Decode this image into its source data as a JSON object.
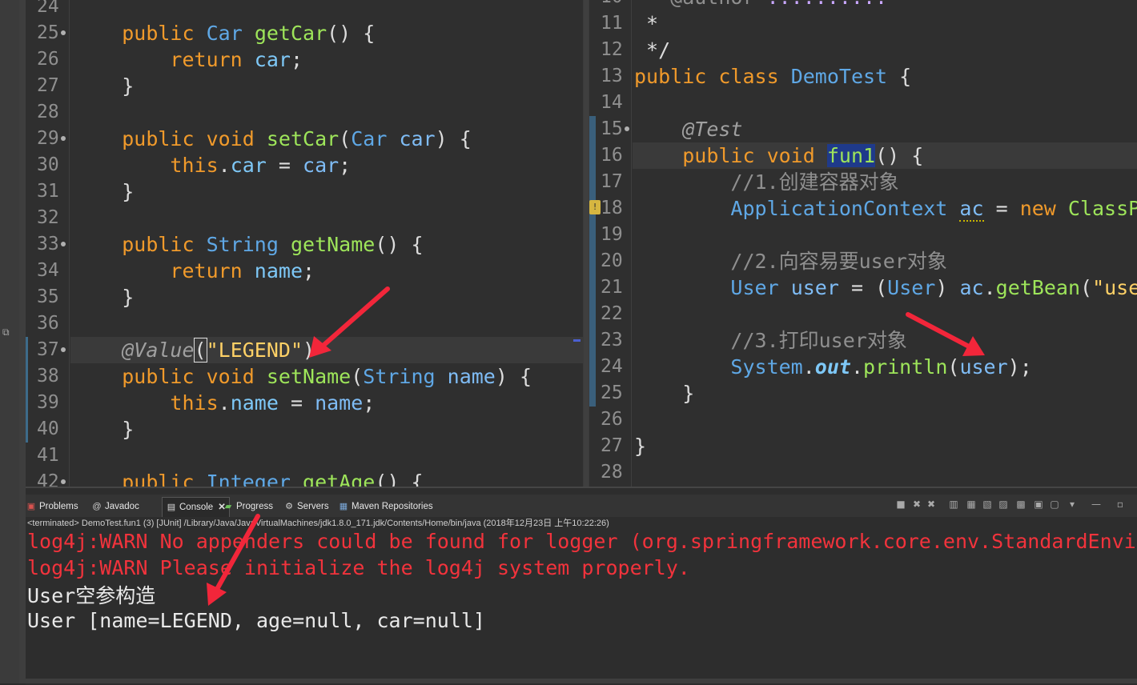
{
  "left_editor": {
    "lines": [
      {
        "num": "24",
        "fold": false,
        "html": ""
      },
      {
        "num": "25",
        "fold": true,
        "html": "    <span class=\"kw\">public</span> <span class=\"ty\">Car</span> <span class=\"fn\">getCar</span>() {"
      },
      {
        "num": "26",
        "fold": false,
        "html": "        <span class=\"kw\">return</span> <span class=\"fld\">car</span>;"
      },
      {
        "num": "27",
        "fold": false,
        "html": "    }"
      },
      {
        "num": "28",
        "fold": false,
        "html": ""
      },
      {
        "num": "29",
        "fold": true,
        "html": "    <span class=\"kw\">public void</span> <span class=\"fn\">setCar</span>(<span class=\"ty\">Car</span> <span class=\"vr\">car</span>) {"
      },
      {
        "num": "30",
        "fold": false,
        "html": "        <span class=\"kw\">this</span>.<span class=\"fld\">car</span> = <span class=\"vr\">car</span>;"
      },
      {
        "num": "31",
        "fold": false,
        "html": "    }"
      },
      {
        "num": "32",
        "fold": false,
        "html": ""
      },
      {
        "num": "33",
        "fold": true,
        "html": "    <span class=\"kw\">public</span> <span class=\"ty\">String</span> <span class=\"fn\">getName</span>() {"
      },
      {
        "num": "34",
        "fold": false,
        "html": "        <span class=\"kw\">return</span> <span class=\"fld\">name</span>;"
      },
      {
        "num": "35",
        "fold": false,
        "html": "    }"
      },
      {
        "num": "36",
        "fold": false,
        "html": ""
      },
      {
        "num": "37",
        "fold": true,
        "current": true,
        "marker": true,
        "html": "    <span class=\"an\">@Value</span><span class=\"bracebox\">(</span><span class=\"st\">\"LEGEND\"</span>)"
      },
      {
        "num": "38",
        "fold": false,
        "marker": true,
        "html": "    <span class=\"kw\">public void</span> <span class=\"fn\">setName</span>(<span class=\"ty\">String</span> <span class=\"vr\">name</span>) {"
      },
      {
        "num": "39",
        "fold": false,
        "marker": true,
        "html": "        <span class=\"kw\">this</span>.<span class=\"fld\">name</span> = <span class=\"vr\">name</span>;"
      },
      {
        "num": "40",
        "fold": false,
        "marker": true,
        "html": "    }"
      },
      {
        "num": "41",
        "fold": false,
        "html": ""
      },
      {
        "num": "42",
        "fold": true,
        "html": "    <span class=\"kw\">public</span> <span class=\"ty\">Integer</span> <span class=\"fn\">getAge</span>() {"
      }
    ]
  },
  "right_editor": {
    "lines": [
      {
        "num": "10",
        "fold": false,
        "html": " * <span class=\"cm\">@author</span> <span class=\"redu\">..........</span>"
      },
      {
        "num": "11",
        "fold": false,
        "html": " *"
      },
      {
        "num": "12",
        "fold": false,
        "html": " */"
      },
      {
        "num": "13",
        "fold": false,
        "html": "<span class=\"kw\">public class</span> <span class=\"ty\">DemoTest</span> {"
      },
      {
        "num": "14",
        "fold": false,
        "html": ""
      },
      {
        "num": "15",
        "fold": true,
        "marker": true,
        "html": "    <span class=\"an\">@Test</span>"
      },
      {
        "num": "16",
        "fold": false,
        "current": true,
        "marker": true,
        "html": "    <span class=\"kw\">public void</span> <span class=\"fn fnhl\">fun1</span>() {"
      },
      {
        "num": "17",
        "fold": false,
        "marker": true,
        "html": "        <span class=\"cm\">//1.创建容器对象</span>"
      },
      {
        "num": "18",
        "fold": false,
        "marker": true,
        "warn": true,
        "html": "        <span class=\"ty\">ApplicationContext</span> <span class=\"vr warnu\">ac</span> = <span class=\"kw\">new</span> <span class=\"fn\">ClassPat</span>"
      },
      {
        "num": "19",
        "fold": false,
        "marker": true,
        "html": ""
      },
      {
        "num": "20",
        "fold": false,
        "marker": true,
        "html": "        <span class=\"cm\">//2.向容易要user对象</span>"
      },
      {
        "num": "21",
        "fold": false,
        "marker": true,
        "html": "        <span class=\"ty\">User</span> <span class=\"vr\">user</span> = (<span class=\"ty\">User</span>) <span class=\"vr\">ac</span>.<span class=\"fn\">getBean</span>(<span class=\"st\">\"user\"</span>"
      },
      {
        "num": "22",
        "fold": false,
        "marker": true,
        "html": ""
      },
      {
        "num": "23",
        "fold": false,
        "marker": true,
        "html": "        <span class=\"cm\">//3.打印user对象</span>"
      },
      {
        "num": "24",
        "fold": false,
        "marker": true,
        "html": "        <span class=\"ty\">System</span>.<span class=\"sfld\">out</span>.<span class=\"fn\">println</span>(<span class=\"vr\">user</span>);"
      },
      {
        "num": "25",
        "fold": false,
        "marker": true,
        "html": "    }"
      },
      {
        "num": "26",
        "fold": false,
        "html": ""
      },
      {
        "num": "27",
        "fold": false,
        "html": "}"
      },
      {
        "num": "28",
        "fold": false,
        "html": ""
      }
    ]
  },
  "console_panel": {
    "tabs": [
      {
        "label": "Problems",
        "icon": "problems-icon",
        "glyph": "▣",
        "color": "#d9534f"
      },
      {
        "label": "Javadoc",
        "icon": "javadoc-icon",
        "glyph": "@",
        "color": "#cfcfcf"
      },
      {
        "label": "Console",
        "icon": "console-icon",
        "glyph": "▤",
        "color": "#dddddd",
        "active": true
      },
      {
        "label": "Progress",
        "icon": "progress-icon",
        "glyph": "▰",
        "color": "#6bbf5b"
      },
      {
        "label": "Servers",
        "icon": "servers-icon",
        "glyph": "⚙",
        "color": "#cfcfcf"
      },
      {
        "label": "Maven Repositories",
        "icon": "maven-repositories-icon",
        "glyph": "▦",
        "color": "#7aa7d8"
      }
    ],
    "close_glyph": "✕",
    "status": "<terminated> DemoTest.fun1 (3) [JUnit] /Library/Java/JavaVirtualMachines/jdk1.8.0_171.jdk/Contents/Home/bin/java (2018年12月23日 上午10:22:26)",
    "output": [
      {
        "text": "log4j:WARN No appenders could be found for logger (org.springframework.core.env.StandardEnvironm",
        "kind": "err"
      },
      {
        "text": "log4j:WARN Please initialize the log4j system properly.",
        "kind": "err"
      },
      {
        "text": "User空参构造",
        "kind": "std"
      },
      {
        "text": "User [name=LEGEND, age=null, car=null]",
        "kind": "std"
      }
    ],
    "toolbar_icons": [
      {
        "name": "terminate-icon",
        "glyph": "■"
      },
      {
        "name": "remove-launch-icon",
        "glyph": "✖"
      },
      {
        "name": "remove-all-icon",
        "glyph": "✖"
      },
      {
        "name": "scroll-lock-icon",
        "glyph": "▥"
      },
      {
        "name": "show-stdout-icon",
        "glyph": "▦"
      },
      {
        "name": "show-stderr-icon",
        "glyph": "▧"
      },
      {
        "name": "word-wrap-icon",
        "glyph": "▨"
      },
      {
        "name": "pin-console-icon",
        "glyph": "▩"
      },
      {
        "name": "display-console-icon",
        "glyph": "▣"
      },
      {
        "name": "open-console-icon",
        "glyph": "▢"
      },
      {
        "name": "new-console-icon",
        "glyph": "▾"
      },
      {
        "name": "minimize-icon",
        "glyph": "—"
      },
      {
        "name": "maximize-icon",
        "glyph": "▫"
      }
    ]
  },
  "colors": {
    "arrow": "#f2263a",
    "keyword": "#f09a2b",
    "type": "#5fa8e6",
    "method": "#9ee55a",
    "string": "#ffd166",
    "error_text": "#f2333c"
  }
}
